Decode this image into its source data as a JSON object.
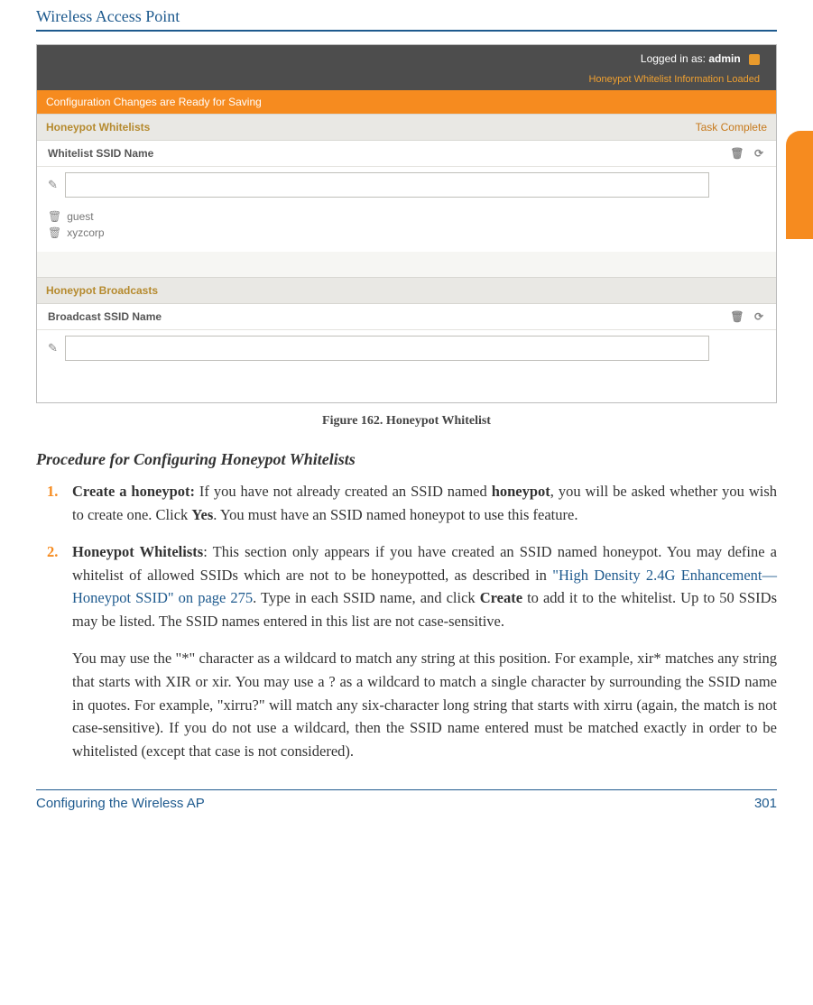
{
  "header": {
    "title": "Wireless Access Point"
  },
  "screenshot": {
    "topbar": {
      "logged_prefix": "Logged in as:",
      "user": "admin",
      "status": "Honeypot Whitelist Information Loaded"
    },
    "change_bar": "Configuration Changes are Ready for Saving",
    "whitelists": {
      "header": "Honeypot Whitelists",
      "task": "Task Complete",
      "column": "Whitelist SSID Name",
      "items": [
        "guest",
        "xyzcorp"
      ]
    },
    "broadcasts": {
      "header": "Honeypot Broadcasts",
      "column": "Broadcast SSID Name"
    }
  },
  "caption": "Figure 162. Honeypot Whitelist",
  "subheading": "Procedure for Configuring Honeypot Whitelists",
  "items": [
    {
      "num": "1.",
      "lead_bold": "Create a honeypot:",
      "text_a": " If you have not already created an SSID named ",
      "inline_bold_a": "honeypot",
      "text_b": ", you will be asked whether you wish to create one. Click ",
      "inline_bold_b": "Yes",
      "text_c": ". You must have an SSID named honeypot to use this feature."
    },
    {
      "num": "2.",
      "lead_bold": "Honeypot Whitelists",
      "text_a": ": This section only appears if you have created an SSID named honeypot. You may define a whitelist of allowed SSIDs which are not to be honeypotted, as described in ",
      "link": "\"High Density 2.4G Enhancement—Honeypot SSID\" on page 275",
      "text_b": ". Type in each SSID name, and click ",
      "inline_bold_a": "Create",
      "text_c": " to add it to the whitelist. Up to 50 SSIDs may be listed. The SSID names entered in this list are not case-sensitive."
    }
  ],
  "continuation": {
    "p1_a": "You may use the \"",
    "p1_star": "*",
    "p1_b": "\" character as a wildcard to match any string at this position. For example, xir* matches any string that starts with ",
    "p1_xir_upper": "XIR",
    "p1_or": " or ",
    "p1_xir_lower": "xir",
    "p1_c": ". You may use a ",
    "p1_q": "?",
    "p1_d": " as a wildcard to match a single character by surrounding the SSID name in quotes. For example, \"",
    "p1_xirruq": "xirru?",
    "p1_e": "\" will match any six-character long string that starts with ",
    "p1_xirru": "xirru",
    "p1_f": " (again, the match is not case-sensitive). If you do not use a wildcard, then the SSID name entered must be matched exactly in order to be whitelisted (except that case is not considered)."
  },
  "footer": {
    "left": "Configuring the Wireless AP",
    "right": "301"
  }
}
